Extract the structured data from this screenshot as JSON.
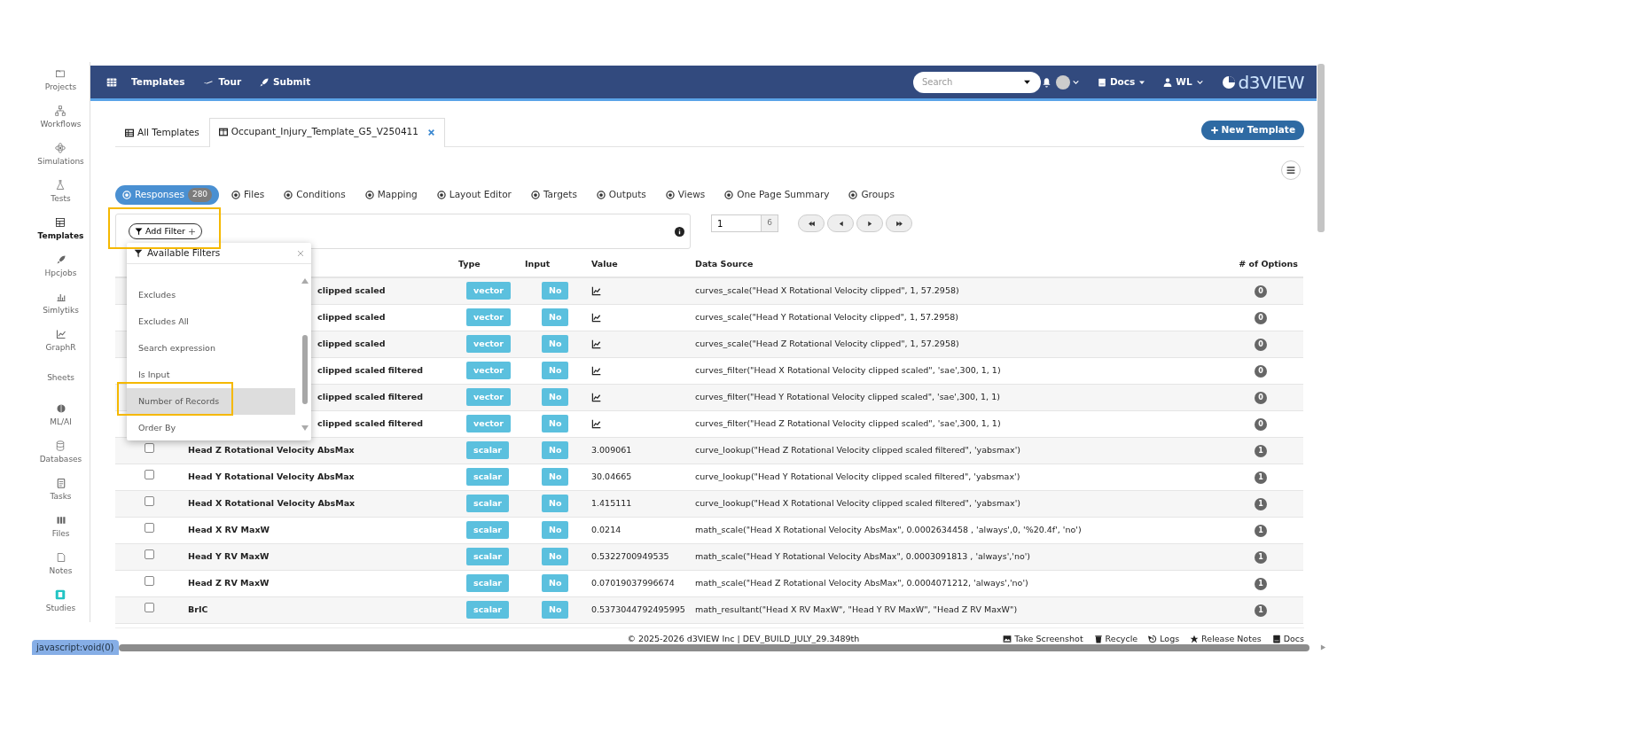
{
  "sidebar": {
    "items": [
      {
        "label": "Projects",
        "selected": false
      },
      {
        "label": "Workflows",
        "selected": false
      },
      {
        "label": "Simulations",
        "selected": false
      },
      {
        "label": "Tests",
        "selected": false
      },
      {
        "label": "Templates",
        "selected": true
      },
      {
        "label": "Hpcjobs",
        "selected": false
      },
      {
        "label": "Simlytiks",
        "selected": false
      },
      {
        "label": "GraphR",
        "selected": false
      },
      {
        "label": "Sheets",
        "selected": false
      },
      {
        "label": "ML/AI",
        "selected": false
      },
      {
        "label": "Databases",
        "selected": false
      },
      {
        "label": "Tasks",
        "selected": false
      },
      {
        "label": "Files",
        "selected": false
      },
      {
        "label": "Notes",
        "selected": false
      },
      {
        "label": "Studies",
        "selected": false
      }
    ]
  },
  "navbar": {
    "menu": [
      {
        "label": "Templates"
      },
      {
        "label": "Tour"
      },
      {
        "label": "Submit"
      }
    ],
    "search": {
      "placeholder": "Search"
    },
    "docs": "Docs",
    "user": "WL",
    "logo": "d3VIEW"
  },
  "page_tabs": [
    {
      "label": "All Templates",
      "selected": false
    },
    {
      "label": "Occupant_Injury_Template_G5_V250411",
      "selected": true
    }
  ],
  "new_template_button": "New Template",
  "module_tabs": [
    {
      "label": "Responses",
      "selected": true,
      "count": "280"
    },
    {
      "label": "Files",
      "selected": false
    },
    {
      "label": "Conditions",
      "selected": false
    },
    {
      "label": "Mapping",
      "selected": false
    },
    {
      "label": "Layout Editor",
      "selected": false
    },
    {
      "label": "Targets",
      "selected": false
    },
    {
      "label": "Outputs",
      "selected": false
    },
    {
      "label": "Views",
      "selected": false
    },
    {
      "label": "One Page Summary",
      "selected": false
    },
    {
      "label": "Groups",
      "selected": false
    }
  ],
  "filter_bar": {
    "add_filter": "Add Filter"
  },
  "pagination": {
    "page": "1",
    "total": "6"
  },
  "table": {
    "columns": [
      "Type",
      "Input",
      "Value",
      "Data Source",
      "# of Options"
    ],
    "rows": [
      {
        "name": "clipped scaled",
        "name_cut": true,
        "type": "vector",
        "input": "No",
        "value_icon": true,
        "source": "curves_scale(\"Head X Rotational Velocity clipped\", 1, 57.2958)",
        "options": "0"
      },
      {
        "name": "clipped scaled",
        "name_cut": true,
        "type": "vector",
        "input": "No",
        "value_icon": true,
        "source": "curves_scale(\"Head Y Rotational Velocity clipped\", 1, 57.2958)",
        "options": "0"
      },
      {
        "name": "clipped scaled",
        "name_cut": true,
        "type": "vector",
        "input": "No",
        "value_icon": true,
        "source": "curves_scale(\"Head Z Rotational Velocity clipped\", 1, 57.2958)",
        "options": "0"
      },
      {
        "name": "clipped scaled filtered",
        "name_cut": true,
        "type": "vector",
        "input": "No",
        "value_icon": true,
        "source": "curves_filter(\"Head X Rotational Velocity clipped scaled\", 'sae',300, 1, 1)",
        "options": "0"
      },
      {
        "name": "clipped scaled filtered",
        "name_cut": true,
        "type": "vector",
        "input": "No",
        "value_icon": true,
        "source": "curves_filter(\"Head Y Rotational Velocity clipped scaled\", 'sae',300, 1, 1)",
        "options": "0"
      },
      {
        "name": "clipped scaled filtered",
        "name_cut": true,
        "type": "vector",
        "input": "No",
        "value_icon": true,
        "source": "curves_filter(\"Head Z Rotational Velocity clipped scaled\", 'sae',300, 1, 1)",
        "options": "0"
      },
      {
        "checked": false,
        "name": "Head Z Rotational Velocity AbsMax",
        "type": "scalar",
        "input": "No",
        "value": "3.009061",
        "source": "curve_lookup(\"Head Z Rotational Velocity clipped scaled filtered\", 'yabsmax')",
        "options": "1"
      },
      {
        "checked": false,
        "name": "Head Y Rotational Velocity AbsMax",
        "type": "scalar",
        "input": "No",
        "value": "30.04665",
        "source": "curve_lookup(\"Head Y Rotational Velocity clipped scaled filtered\", 'yabsmax')",
        "options": "1"
      },
      {
        "checked": false,
        "name": "Head X Rotational Velocity AbsMax",
        "type": "scalar",
        "input": "No",
        "value": "1.415111",
        "source": "curve_lookup(\"Head X Rotational Velocity clipped scaled filtered\", 'yabsmax')",
        "options": "1"
      },
      {
        "checked": false,
        "name": "Head X RV MaxW",
        "type": "scalar",
        "input": "No",
        "value": "0.0214",
        "source": "math_scale(\"Head X Rotational Velocity AbsMax\", 0.0002634458 , 'always',0, '%20.4f', 'no')",
        "options": "1"
      },
      {
        "checked": false,
        "name": "Head Y RV MaxW",
        "type": "scalar",
        "input": "No",
        "value": "0.5322700949535",
        "source": "math_scale(\"Head Y Rotational Velocity AbsMax\", 0.0003091813 , 'always','no')",
        "options": "1"
      },
      {
        "checked": false,
        "name": "Head Z RV MaxW",
        "type": "scalar",
        "input": "No",
        "value": "0.07019037996674",
        "source": "math_scale(\"Head Z Rotational Velocity AbsMax\", 0.0004071212, 'always','no')",
        "options": "1"
      },
      {
        "checked": false,
        "name": "BrIC",
        "type": "scalar",
        "input": "No",
        "value": "0.5373044792495995",
        "source": "math_resultant(\"Head X RV MaxW\", \"Head Y RV MaxW\", \"Head Z RV MaxW\")",
        "options": "1"
      }
    ]
  },
  "filter_dropdown": {
    "title": "Available Filters",
    "items": [
      {
        "label": "Excludes",
        "selected": false
      },
      {
        "label": "Excludes All",
        "selected": false
      },
      {
        "label": "Search expression",
        "selected": false
      },
      {
        "label": "Is Input",
        "selected": false
      },
      {
        "label": "Number of Records",
        "selected": true
      },
      {
        "label": "Order By",
        "selected": false
      }
    ]
  },
  "footer": {
    "copyright": "© 2025-2026 d3VIEW Inc | DEV_BUILD_JULY_29.3489th",
    "links": [
      "Take Screenshot",
      "Recycle",
      "Logs",
      "Release Notes",
      "Docs"
    ]
  },
  "status_bar": "javascript:void(0)"
}
